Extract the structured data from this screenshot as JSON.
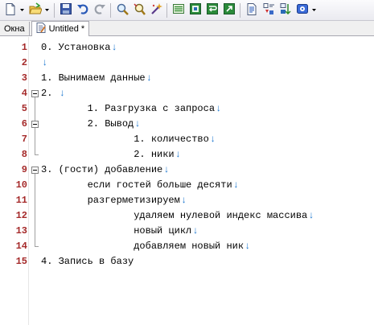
{
  "toolbar": {
    "buttons": [
      {
        "icon": "new-file-icon"
      },
      {
        "icon": "open-folder-icon"
      },
      {
        "icon": "save-icon"
      },
      {
        "icon": "undo-icon"
      },
      {
        "icon": "redo-icon"
      },
      {
        "icon": "find-icon"
      },
      {
        "icon": "find-replace-icon"
      },
      {
        "icon": "magic-wand-icon"
      },
      {
        "icon": "list-icon"
      },
      {
        "icon": "screen-icon"
      },
      {
        "icon": "word-wrap-icon"
      },
      {
        "icon": "export-icon"
      },
      {
        "icon": "document-icon"
      },
      {
        "icon": "filter-icon"
      },
      {
        "icon": "sort-icon"
      },
      {
        "icon": "settings-icon"
      }
    ]
  },
  "tabs": {
    "windows_label": "Окна",
    "document_label": "Untitled *"
  },
  "editor": {
    "eol_marker": "↓",
    "lines": [
      {
        "num": "1",
        "text": "0. Установка",
        "eol": true
      },
      {
        "num": "2",
        "text": "",
        "eol": true
      },
      {
        "num": "3",
        "text": "1. Вынимаем данные",
        "eol": true
      },
      {
        "num": "4",
        "text": "2. ",
        "eol": true
      },
      {
        "num": "5",
        "text": "        1. Разгрузка с запроса",
        "eol": true
      },
      {
        "num": "6",
        "text": "        2. Вывод",
        "eol": true
      },
      {
        "num": "7",
        "text": "                1. количество",
        "eol": true
      },
      {
        "num": "8",
        "text": "                2. ники",
        "eol": true
      },
      {
        "num": "9",
        "text": "3. (гости) добавление",
        "eol": true
      },
      {
        "num": "10",
        "text": "        если гостей больше десяти",
        "eol": true
      },
      {
        "num": "11",
        "text": "        разгерметизируем",
        "eol": true
      },
      {
        "num": "12",
        "text": "                удаляем нулевой индекс массива",
        "eol": true
      },
      {
        "num": "13",
        "text": "                новый цикл",
        "eol": true
      },
      {
        "num": "14",
        "text": "                добавляем новый ник",
        "eol": true
      },
      {
        "num": "15",
        "text": "4. Запись в базу",
        "eol": false
      }
    ]
  }
}
